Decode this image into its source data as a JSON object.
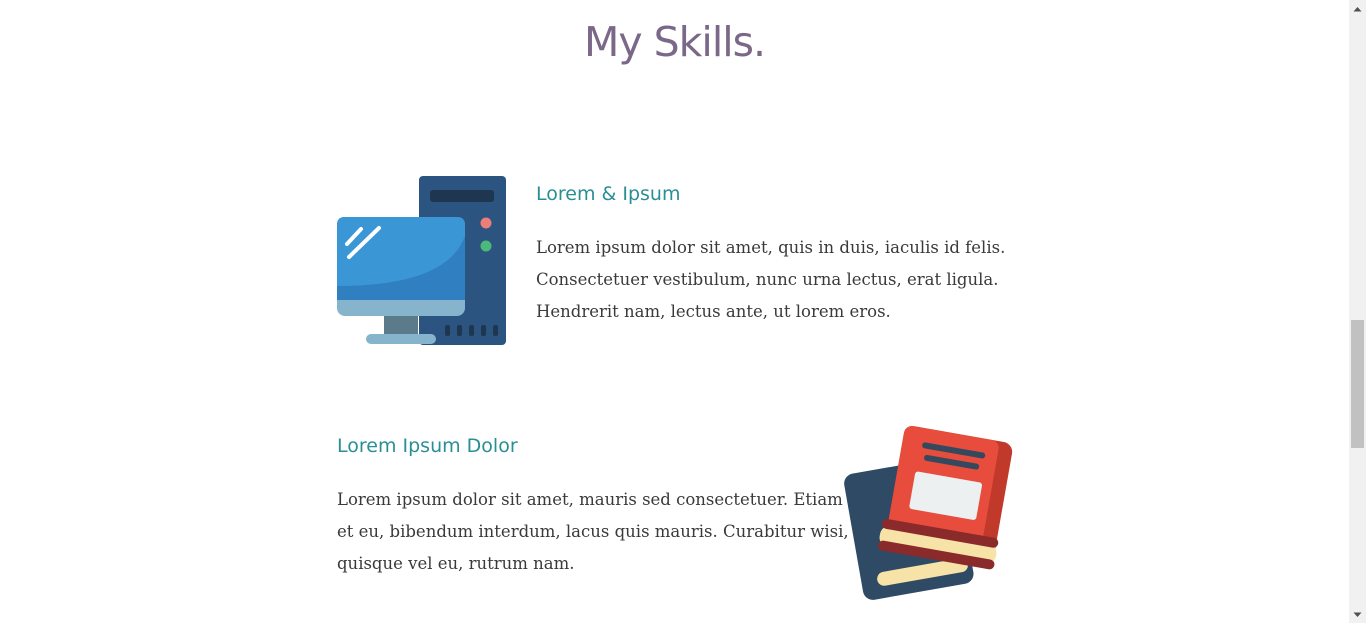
{
  "section": {
    "title": "My Skills."
  },
  "skills": [
    {
      "title": "Lorem & Ipsum",
      "lines": [
        "Lorem ipsum dolor sit amet, quis in duis, iaculis id felis.",
        "Consectetuer vestibulum, nunc urna lectus, erat ligula.",
        "Hendrerit nam, lectus ante, ut lorem eros."
      ],
      "icon": "desktop-computer-icon"
    },
    {
      "title": "Lorem Ipsum Dolor",
      "lines": [
        "Lorem ipsum dolor sit amet, mauris sed consectetuer. Etiam",
        "et eu, bibendum interdum, lacus quis mauris. Curabitur wisi,",
        "quisque vel eu, rutrum nam."
      ],
      "icon": "books-icon"
    }
  ],
  "colors": {
    "title": "#7b6888",
    "skill_title": "#2a8f94",
    "body_text": "#3a3a3a"
  }
}
